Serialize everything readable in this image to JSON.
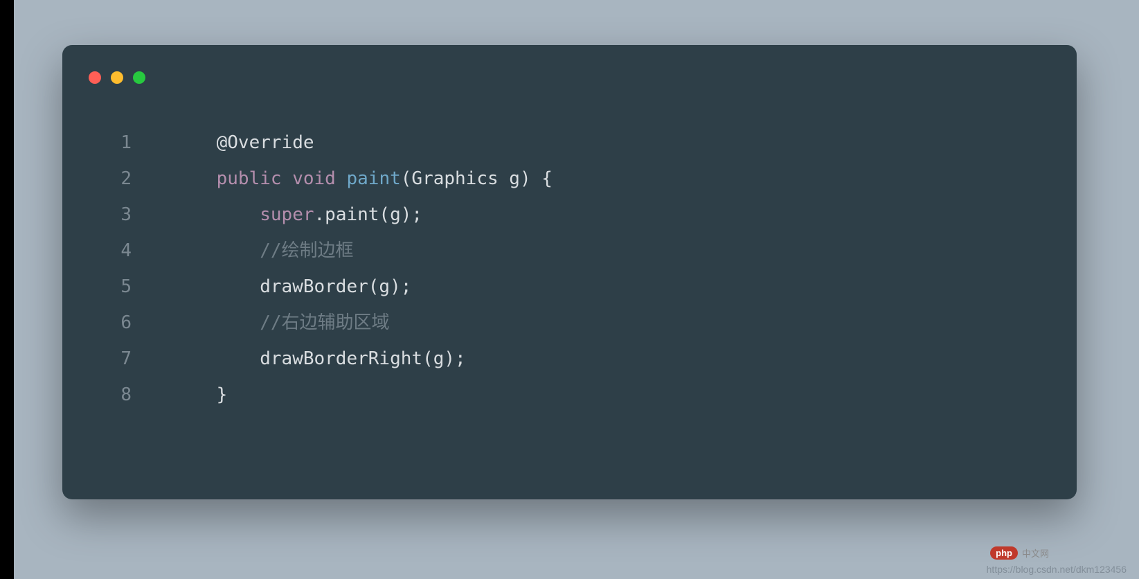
{
  "code": {
    "lines": [
      {
        "num": "1",
        "indent": "    ",
        "tokens": [
          {
            "cls": "tok-ann",
            "t": "@Override"
          }
        ]
      },
      {
        "num": "2",
        "indent": "    ",
        "tokens": [
          {
            "cls": "tok-kw",
            "t": "public "
          },
          {
            "cls": "tok-kw",
            "t": "void "
          },
          {
            "cls": "tok-fn",
            "t": "paint"
          },
          {
            "cls": "tok-plain",
            "t": "(Graphics g) {"
          }
        ]
      },
      {
        "num": "3",
        "indent": "        ",
        "tokens": [
          {
            "cls": "tok-kw",
            "t": "super"
          },
          {
            "cls": "tok-plain",
            "t": ".paint(g);"
          }
        ]
      },
      {
        "num": "4",
        "indent": "        ",
        "tokens": [
          {
            "cls": "tok-cmt",
            "t": "//绘制边框"
          }
        ]
      },
      {
        "num": "5",
        "indent": "        ",
        "tokens": [
          {
            "cls": "tok-plain",
            "t": "drawBorder(g);"
          }
        ]
      },
      {
        "num": "6",
        "indent": "        ",
        "tokens": [
          {
            "cls": "tok-cmt",
            "t": "//右边辅助区域"
          }
        ]
      },
      {
        "num": "7",
        "indent": "        ",
        "tokens": [
          {
            "cls": "tok-plain",
            "t": "drawBorderRight(g);"
          }
        ]
      },
      {
        "num": "8",
        "indent": "    ",
        "tokens": [
          {
            "cls": "tok-plain",
            "t": "}"
          }
        ]
      }
    ]
  },
  "watermark": {
    "badge_text": "php",
    "badge_cn": "中文网",
    "url": "https://blog.csdn.net/dkm123456"
  }
}
